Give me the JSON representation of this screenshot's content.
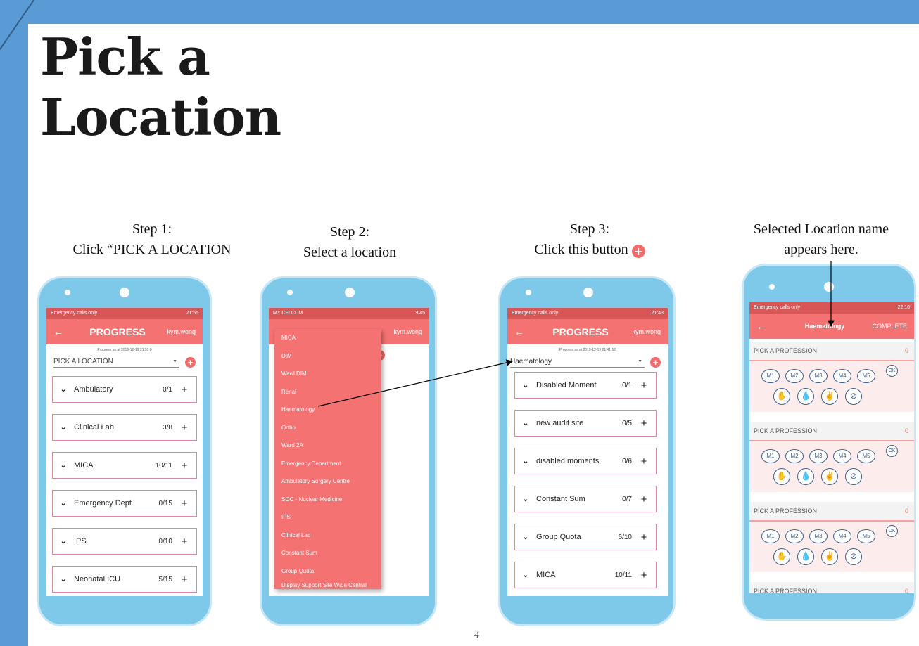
{
  "slide": {
    "title_line1": "Pick a",
    "title_line2": "Location",
    "page_number": "4"
  },
  "captions": {
    "step1_line1": "Step 1:",
    "step1_line2": "Click “PICK A LOCATION",
    "step2_line1": "Step 2:",
    "step2_line2": "Select a location",
    "step3_line1": "Step 3:",
    "step3_line2": "Click this button",
    "step4_line1": "Selected Location name",
    "step4_line2": "appears here."
  },
  "colors": {
    "accent": "#f47272",
    "statusbar": "#d95656",
    "slide_blue": "#5b9bd5",
    "phone_body": "#7ec8ea",
    "card_border": "#d48aa4",
    "moment_button": "#3d5f86"
  },
  "phone1": {
    "status_left": "Emergency calls only",
    "status_right": "21:55",
    "appbar_title": "PROGRESS",
    "appbar_user": "kym.wong",
    "progress_as": "Progress as at 2019-12-19 21:55:0",
    "location_placeholder": "PICK A LOCATION",
    "rows": [
      {
        "name": "Ambulatory",
        "count": "0/1"
      },
      {
        "name": "Clinical Lab",
        "count": "3/8"
      },
      {
        "name": "MICA",
        "count": "10/11"
      },
      {
        "name": "Emergency Dept.",
        "count": "0/15"
      },
      {
        "name": "IPS",
        "count": "0/10"
      },
      {
        "name": "Neonatal ICU",
        "count": "5/15"
      }
    ]
  },
  "phone2": {
    "status_left": "MY CELCOM",
    "status_right": "9:45",
    "appbar_user": "kym.wong",
    "options": [
      "MICA",
      "DIM",
      "Ward DIM",
      "Renal",
      "Haematology",
      "Ortho",
      "Ward 2A",
      "Emergency Department",
      "Ambulatory Surgery Centre",
      "SOC - Nuclear Medicine",
      "IPS",
      "Clinical Lab",
      "Constant Sum",
      "Group Quota",
      "Display Support Site Wide Central"
    ]
  },
  "phone3": {
    "status_left": "Emergency calls only",
    "status_right": "21:43",
    "appbar_title": "PROGRESS",
    "appbar_user": "kym.wong",
    "progress_as": "Progress as at 2019-12-19 21:41:52",
    "location_value": "Haematology",
    "rows": [
      {
        "name": "Disabled Moment",
        "count": "0/1"
      },
      {
        "name": "new audit site",
        "count": "0/5"
      },
      {
        "name": "disabled moments",
        "count": "0/6"
      },
      {
        "name": "Constant Sum",
        "count": "0/7"
      },
      {
        "name": "Group Quota",
        "count": "6/10"
      },
      {
        "name": "MICA",
        "count": "10/11"
      }
    ]
  },
  "phone4": {
    "status_left": "Emergency calls only",
    "status_right": "22:16",
    "appbar_title": "Haematology",
    "appbar_action": "COMPLETE",
    "profession_label": "PICK A PROFESSION",
    "profession_count": "0",
    "moments": [
      "M1",
      "M2",
      "M3",
      "M4",
      "M5"
    ],
    "ok_label": "OK",
    "icons": [
      "hand-rub-icon",
      "hand-wash-icon",
      "glove-icon",
      "no-action-icon"
    ]
  }
}
